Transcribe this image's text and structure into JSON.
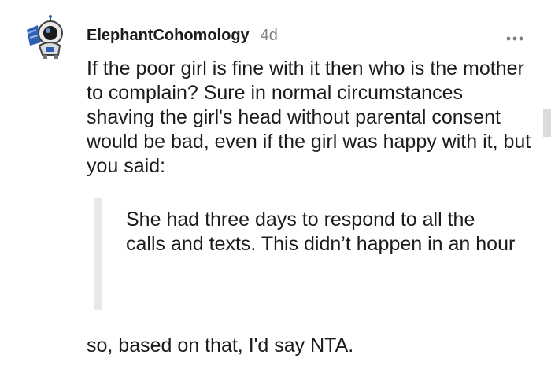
{
  "comment": {
    "username": "ElephantCohomology",
    "age": "4d",
    "body": "If the poor girl is fine with it then who is the mother to complain? Sure in normal circumstances shaving the girl's head without parental consent would be bad, even if the girl was happy with it, but you said:",
    "quote": "She had three days to respond to all the calls and texts. This didn’t happen in an hour",
    "conclusion": "so, based on that, I'd say NTA."
  },
  "icons": {
    "avatar": "astronaut-avatar-icon",
    "more": "more-options-icon"
  },
  "colors": {
    "text": "#1c1c1c",
    "muted": "#7c7c7c",
    "quote_bar": "#e8e8e8",
    "avatar_blue": "#2f5fb5"
  }
}
